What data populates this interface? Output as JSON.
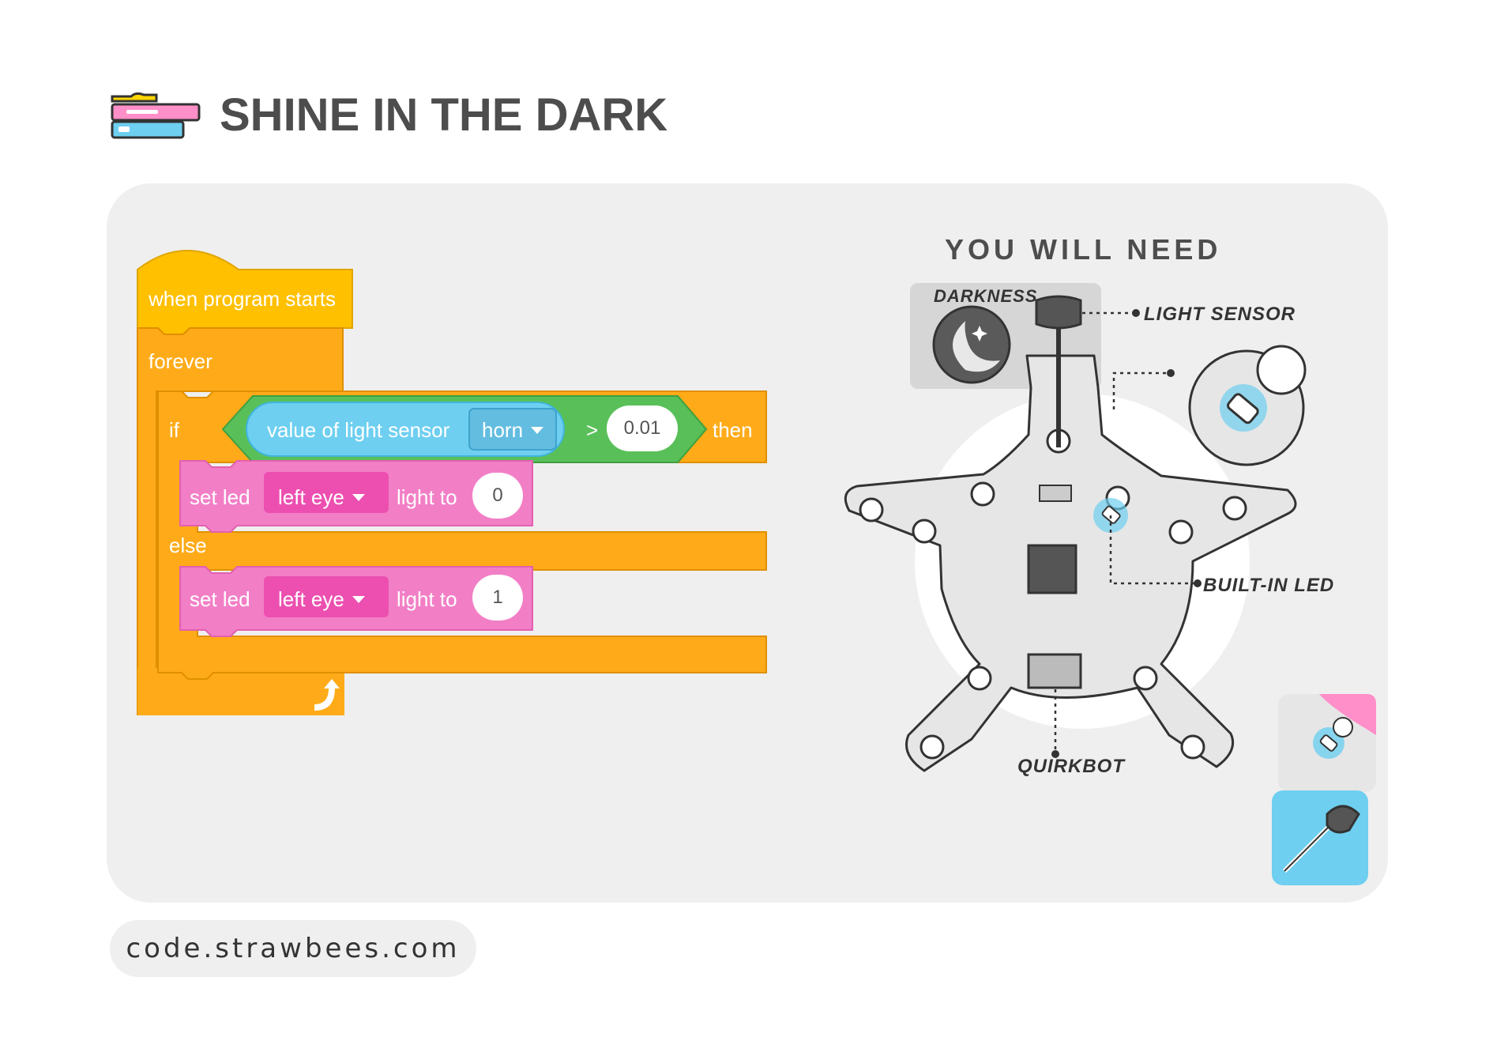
{
  "header": {
    "title": "SHINE IN THE DARK",
    "icon": "blocks-icon"
  },
  "code": {
    "hat": "when program starts",
    "forever": "forever",
    "if": "if",
    "sensor_label": "value of light sensor",
    "sensor_dropdown": "horn",
    "operator": ">",
    "threshold": "0.01",
    "then": "then",
    "else": "else",
    "set_led_1": {
      "label": "set led",
      "target": "left eye",
      "light_to": "light to",
      "value": "0"
    },
    "set_led_2": {
      "label": "set led",
      "target": "left eye",
      "light_to": "light to",
      "value": "1"
    }
  },
  "need": {
    "title": "YOU WILL NEED",
    "darkness": "DARKNESS",
    "light_sensor": "LIGHT SENSOR",
    "built_in_led": "BUILT-IN LED",
    "quirkbot": "QUIRKBOT"
  },
  "footer": {
    "url": "code.strawbees.com"
  },
  "colors": {
    "events": "#ffc000",
    "control": "#ffab19",
    "operator": "#59c059",
    "sensor": "#6ecff0",
    "looks": "#f27fc6",
    "panel": "#efefef"
  }
}
